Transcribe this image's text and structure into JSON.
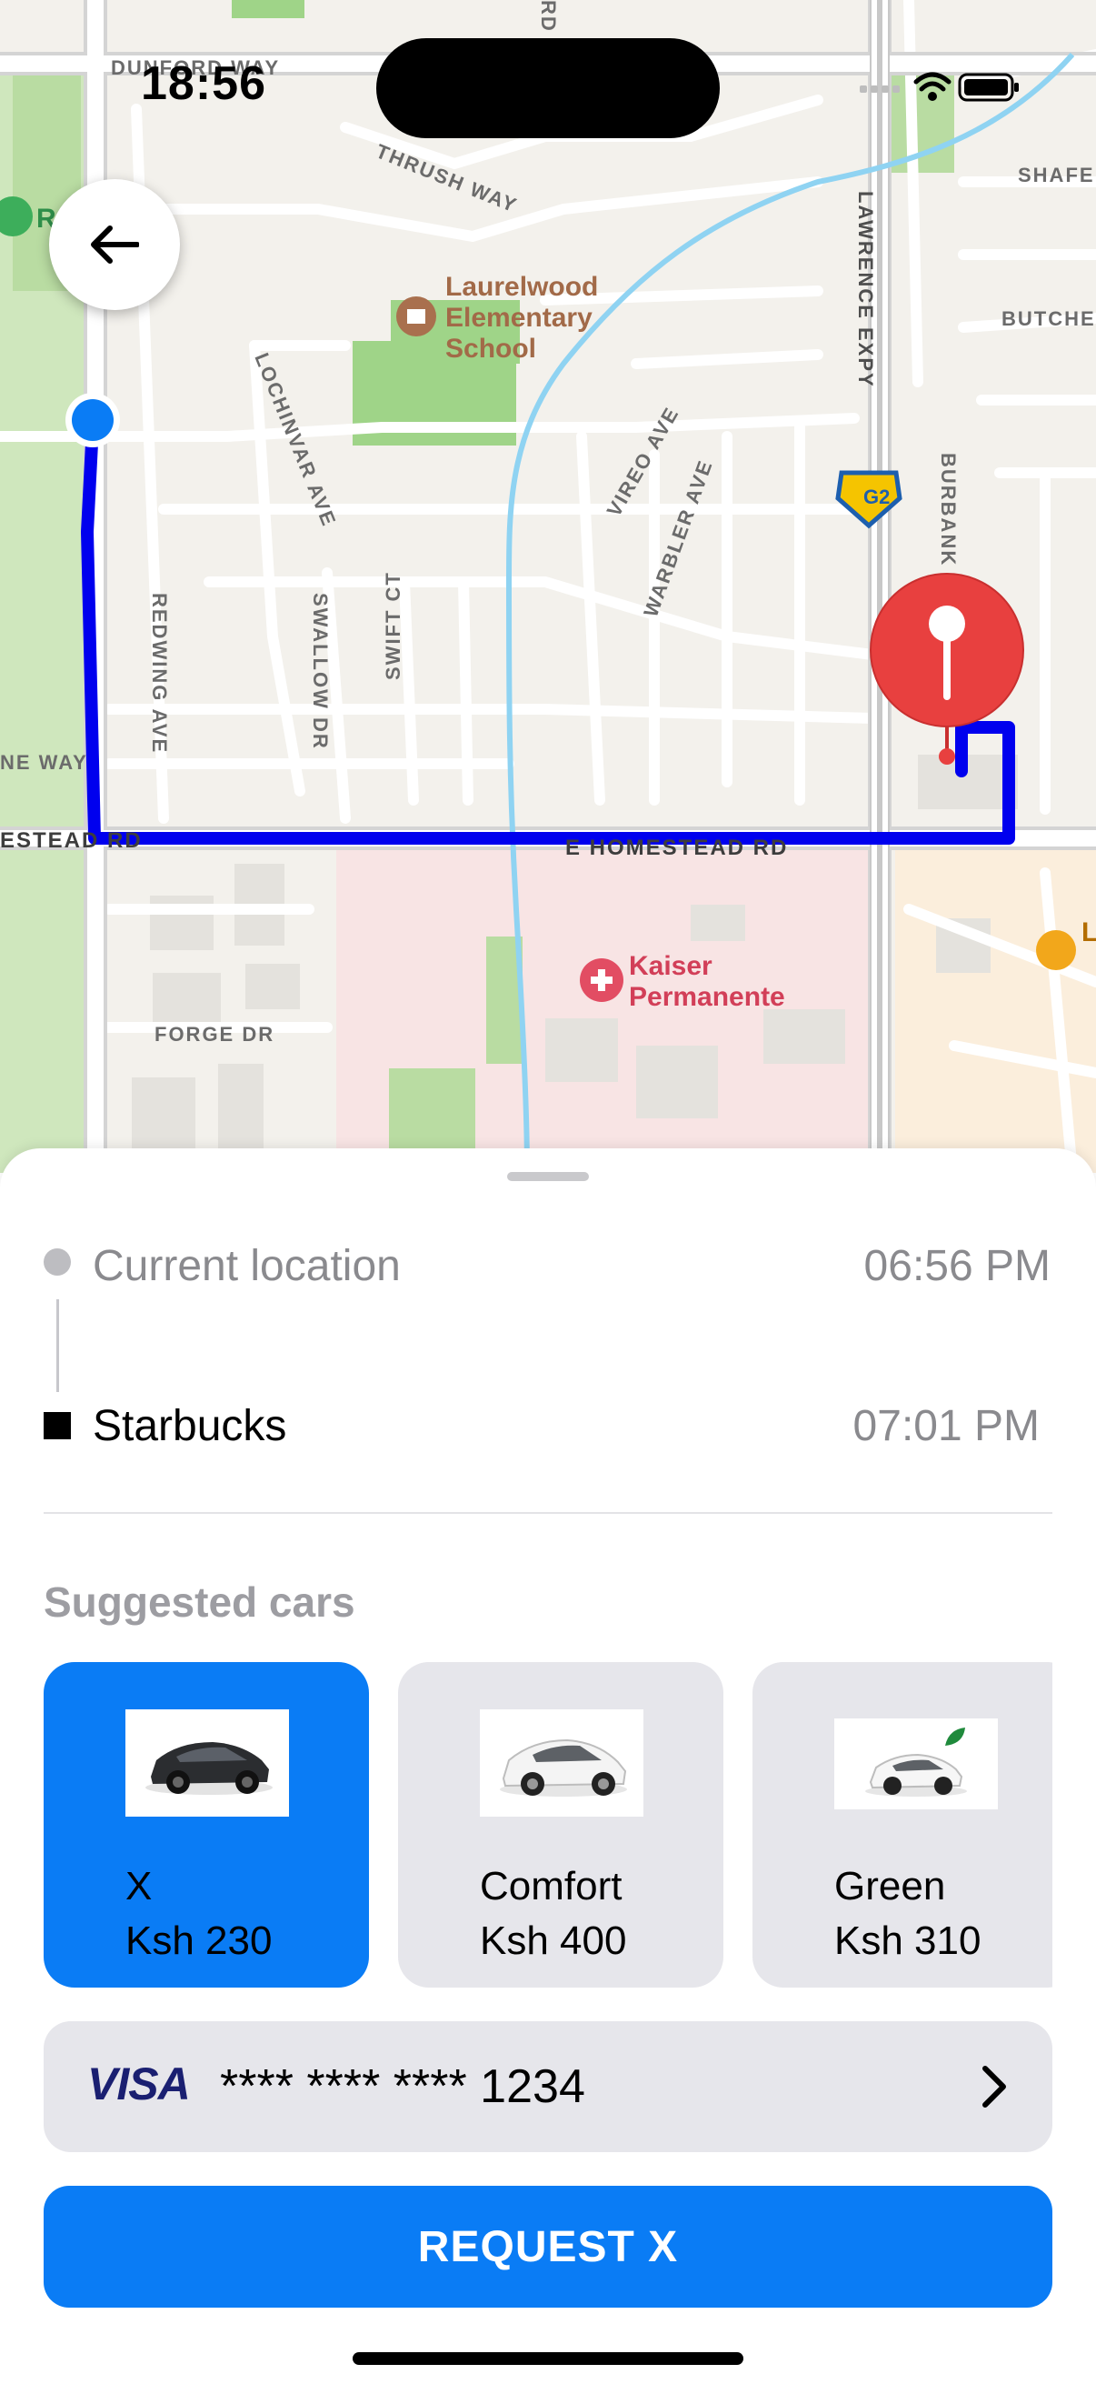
{
  "status_bar": {
    "time": "18:56"
  },
  "map": {
    "streets": {
      "dunford_way": "DUNFORD WAY",
      "thrush_way": "THRUSH WAY",
      "lochinvar_ave": "LOCHINVAR AVE",
      "redwing_ave": "REDWING AVE",
      "swallow_dr": "SWALLOW DR",
      "swift_ct": "SWIFT CT",
      "vireo_ave": "VIREO AVE",
      "warbler_ave": "WARBLER AVE",
      "lawrence_expy": "LAWRENCE EXPY",
      "burbank": "BURBANK",
      "e_homestead_rd": "E HOMESTEAD RD",
      "homestead_rd_left": "ESTEAD RD",
      "ne_way": "NE WAY",
      "forge_dr": "FORGE DR",
      "shafer": "SHAFE",
      "butcher": "BUTCHE",
      "rd_top": "RD"
    },
    "pois": {
      "school": "Laurelwood Elementary School",
      "school_line1": "Laurelwood",
      "school_line2": "Elementary",
      "school_line3": "School",
      "hospital_line1": "Kaiser",
      "hospital_line2": "Permanente",
      "park_partial": "R   ark",
      "right_edge_poi": "L"
    },
    "highway_shield": "G2",
    "colors": {
      "route": "#0000ee",
      "pin": "#e8403f",
      "origin_dot": "#0a7cf5"
    }
  },
  "trip": {
    "origin_label": "Current location",
    "origin_time": "06:56 PM",
    "destination_label": "Starbucks",
    "destination_time": "07:01 PM"
  },
  "suggested": {
    "title": "Suggested cars",
    "cars": [
      {
        "name": "X",
        "price": "Ksh 230",
        "selected": true,
        "icon": "black-sedan-image"
      },
      {
        "name": "Comfort",
        "price": "Ksh 400",
        "selected": false,
        "icon": "white-sedan-image"
      },
      {
        "name": "Green",
        "price": "Ksh 310",
        "selected": false,
        "icon": "white-ev-image"
      }
    ]
  },
  "payment": {
    "brand": "VISA",
    "card_number": "**** **** **** 1234"
  },
  "request_button": "REQUEST X",
  "colors": {
    "accent": "#0a7cf5",
    "card_bg": "#e6e6eb"
  }
}
